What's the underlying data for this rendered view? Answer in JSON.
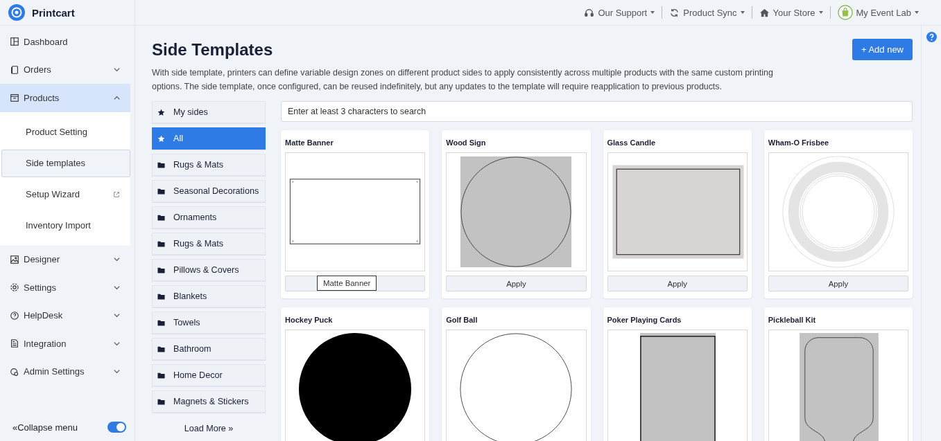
{
  "brand": {
    "name": "Printcart"
  },
  "topbar": {
    "menus": [
      {
        "label": "Our Support"
      },
      {
        "label": "Product Sync"
      },
      {
        "label": "Your Store"
      },
      {
        "label": "My Event Lab"
      }
    ]
  },
  "sidebar": {
    "items": [
      {
        "label": "Dashboard",
        "selected": false
      },
      {
        "label": "Orders",
        "selected": false,
        "expanded": false
      },
      {
        "label": "Products",
        "selected": true,
        "expanded": true,
        "children": [
          {
            "label": "Product Setting",
            "selected": false,
            "external": false
          },
          {
            "label": "Side templates",
            "selected": true,
            "external": false
          },
          {
            "label": "Setup Wizard",
            "selected": false,
            "external": true
          },
          {
            "label": "Inventory Import",
            "selected": false,
            "external": false
          }
        ]
      },
      {
        "label": "Designer",
        "selected": false,
        "expanded": false
      },
      {
        "label": "Settings",
        "selected": false,
        "expanded": false
      },
      {
        "label": "HelpDesk",
        "selected": false,
        "expanded": false
      },
      {
        "label": "Integration",
        "selected": false,
        "expanded": false
      },
      {
        "label": "Admin Settings",
        "selected": false,
        "expanded": false
      }
    ],
    "collapse": {
      "label": "«Collapse menu",
      "on": true
    }
  },
  "page": {
    "title": "Side Templates",
    "description": "With side template, printers can define variable design zones on different product sides to apply consistently across multiple products with the same custom printing options. The side template, once configured, can be reused indefinitely, but any updates to the template will require reapplication to previous products.",
    "add_button": "+ Add new"
  },
  "categories": [
    {
      "label": "My sides",
      "kind": "star",
      "selected": false
    },
    {
      "label": "All",
      "kind": "star",
      "selected": true
    },
    {
      "label": "Rugs & Mats",
      "kind": "folder",
      "selected": false
    },
    {
      "label": "Seasonal Decorations",
      "kind": "folder",
      "selected": false
    },
    {
      "label": "Ornaments",
      "kind": "folder",
      "selected": false
    },
    {
      "label": "Rugs & Mats",
      "kind": "folder",
      "selected": false
    },
    {
      "label": "Pillows & Covers",
      "kind": "folder",
      "selected": false
    },
    {
      "label": "Blankets",
      "kind": "folder",
      "selected": false
    },
    {
      "label": "Towels",
      "kind": "folder",
      "selected": false
    },
    {
      "label": "Bathroom",
      "kind": "folder",
      "selected": false
    },
    {
      "label": "Home Decor",
      "kind": "folder",
      "selected": false
    },
    {
      "label": "Magnets & Stickers",
      "kind": "folder",
      "selected": false
    }
  ],
  "load_more": "Load More »",
  "search": {
    "placeholder": "Enter at least 3 characters to search"
  },
  "templates": [
    {
      "name": "Matte Banner",
      "kind": "banner",
      "tooltip": "Matte Banner"
    },
    {
      "name": "Wood Sign",
      "kind": "gray-circle",
      "button": "Apply"
    },
    {
      "name": "Glass Candle",
      "kind": "gray-rect",
      "button": "Apply"
    },
    {
      "name": "Wham-O Frisbee",
      "kind": "frisbee",
      "button": "Apply"
    },
    {
      "name": "Hockey Puck",
      "kind": "black-circle"
    },
    {
      "name": "Golf Ball",
      "kind": "white-circle"
    },
    {
      "name": "Poker Playing Cards",
      "kind": "card"
    },
    {
      "name": "Pickleball Kit",
      "kind": "paddle"
    }
  ]
}
